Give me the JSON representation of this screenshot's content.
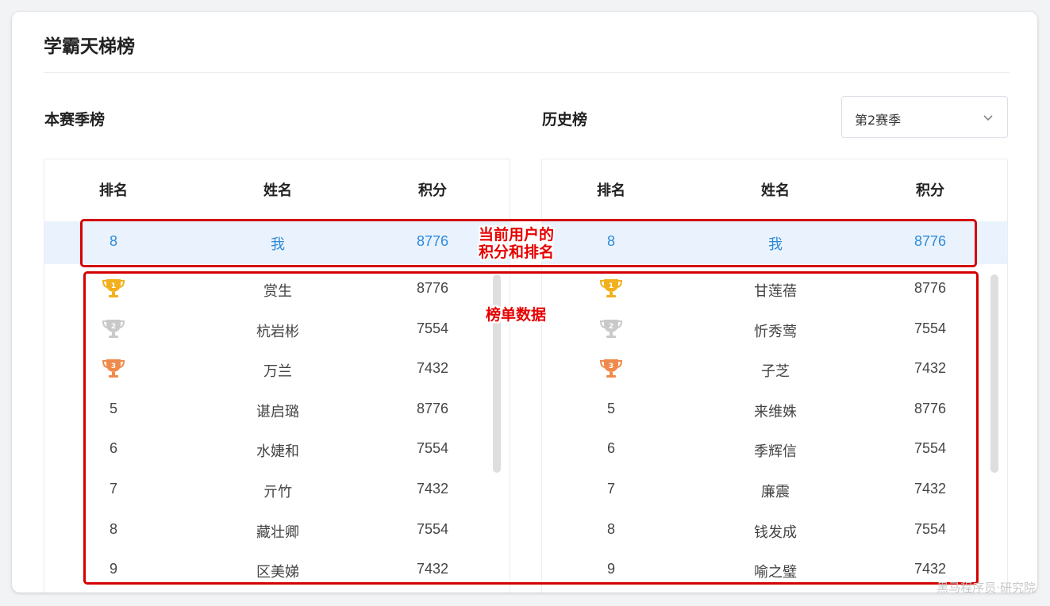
{
  "page": {
    "title": "学霸天梯榜"
  },
  "current_season": {
    "title": "本赛季榜",
    "headers": {
      "rank": "排名",
      "name": "姓名",
      "score": "积分"
    },
    "me": {
      "rank": "8",
      "name": "我",
      "score": "8776"
    },
    "rows": [
      {
        "rank": "1",
        "trophy": "gold",
        "name": "赏生",
        "score": "8776"
      },
      {
        "rank": "2",
        "trophy": "silver",
        "name": "杭岩彬",
        "score": "7554"
      },
      {
        "rank": "3",
        "trophy": "bronze",
        "name": "万兰",
        "score": "7432"
      },
      {
        "rank": "5",
        "name": "谌启璐",
        "score": "8776"
      },
      {
        "rank": "6",
        "name": "水婕和",
        "score": "7554"
      },
      {
        "rank": "7",
        "name": "亓竹",
        "score": "7432"
      },
      {
        "rank": "8",
        "name": "藏壮卿",
        "score": "7554"
      },
      {
        "rank": "9",
        "name": "区美娣",
        "score": "7432"
      }
    ]
  },
  "history": {
    "title": "历史榜",
    "season_select": {
      "value": "第2赛季"
    },
    "headers": {
      "rank": "排名",
      "name": "姓名",
      "score": "积分"
    },
    "me": {
      "rank": "8",
      "name": "我",
      "score": "8776"
    },
    "rows": [
      {
        "rank": "1",
        "trophy": "gold",
        "name": "甘莲蓓",
        "score": "8776"
      },
      {
        "rank": "2",
        "trophy": "silver",
        "name": "忻秀莺",
        "score": "7554"
      },
      {
        "rank": "3",
        "trophy": "bronze",
        "name": "子芝",
        "score": "7432"
      },
      {
        "rank": "5",
        "name": "来维姝",
        "score": "8776"
      },
      {
        "rank": "6",
        "name": "季辉信",
        "score": "7554"
      },
      {
        "rank": "7",
        "name": "廉震",
        "score": "7432"
      },
      {
        "rank": "8",
        "name": "钱发成",
        "score": "7554"
      },
      {
        "rank": "9",
        "name": "喻之璧",
        "score": "7432"
      }
    ]
  },
  "annotations": {
    "me_label_line1": "当前用户的",
    "me_label_line2": "积分和排名",
    "list_label": "榜单数据"
  },
  "watermark": "黑马程序员·研究院",
  "colors": {
    "highlight_row_bg": "#eaf3fd",
    "highlight_text": "#2d8ad9",
    "annotation_red": "#d40000",
    "trophy_gold": "#f2b01e",
    "trophy_silver": "#c9c9c9",
    "trophy_bronze": "#f08a4b"
  }
}
